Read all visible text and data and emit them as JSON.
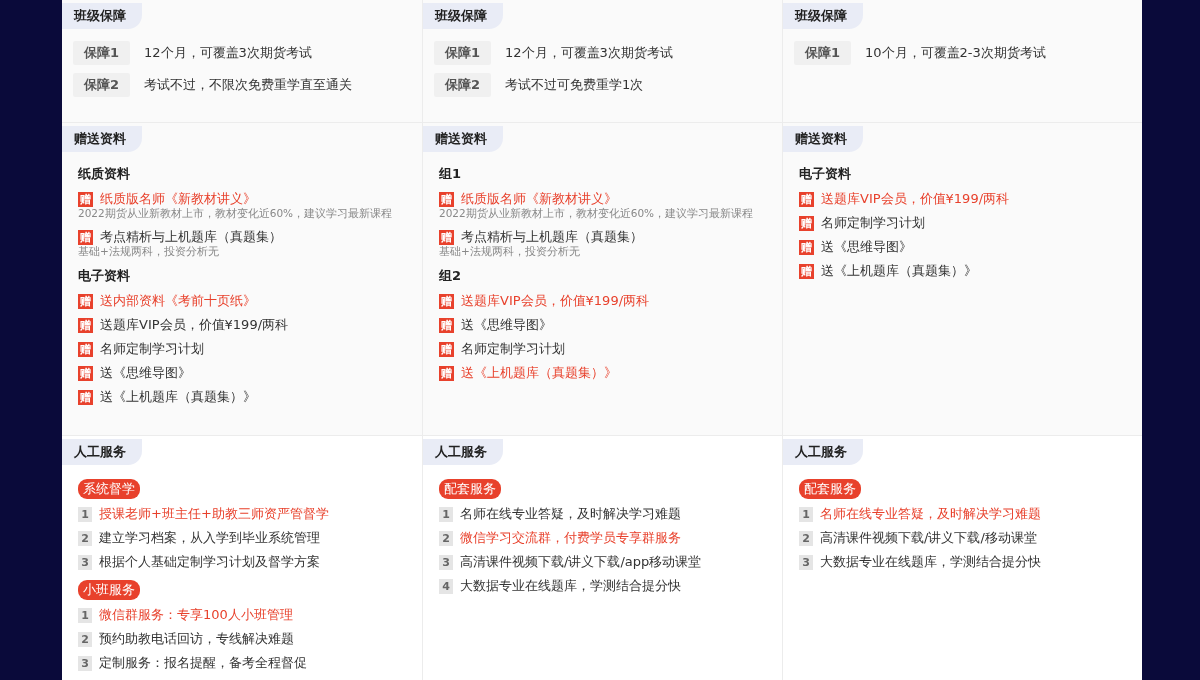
{
  "sections": [
    {
      "kind": "guarantee",
      "columns": [
        {
          "titles": [
            "班级保障"
          ],
          "rows": [
            {
              "label": "保障1",
              "text": "12个月，可覆盖3次期货考试"
            },
            {
              "label": "保障2",
              "text": "考试不过，不限次免费重学直至通关"
            }
          ]
        },
        {
          "titles": [
            "班级保障"
          ],
          "rows": [
            {
              "label": "保障1",
              "text": "12个月，可覆盖3次期货考试"
            },
            {
              "label": "保障2",
              "text": "考试不过可免费重学1次"
            }
          ]
        },
        {
          "titles": [
            "班级保障"
          ],
          "rows": [
            {
              "label": "保障1",
              "text": "10个月，可覆盖2-3次期货考试"
            }
          ]
        }
      ]
    },
    {
      "kind": "materials",
      "columns": [
        {
          "titles": [
            "赠送资料"
          ],
          "groups": [
            {
              "heading": "纸质资料",
              "items": [
                {
                  "mark": "赠",
                  "text": "纸质版名师《新教材讲义》",
                  "highlight": true,
                  "note": "2022期货从业新教材上市，教材变化近60%，建议学习最新课程"
                },
                {
                  "mark": "赠",
                  "text": "考点精析与上机题库（真题集）",
                  "highlight": false,
                  "note": "基础+法规两科，投资分析无"
                }
              ]
            },
            {
              "heading": "电子资料",
              "items": [
                {
                  "mark": "赠",
                  "text": "送内部资料《考前十页纸》",
                  "highlight": true
                },
                {
                  "mark": "赠",
                  "text": "送题库VIP会员，价值¥199/两科",
                  "highlight": false
                },
                {
                  "mark": "赠",
                  "text": "名师定制学习计划",
                  "highlight": false
                },
                {
                  "mark": "赠",
                  "text": "送《思维导图》",
                  "highlight": false
                },
                {
                  "mark": "赠",
                  "text": "送《上机题库（真题集）》",
                  "highlight": false
                }
              ]
            }
          ]
        },
        {
          "titles": [
            "赠送资料"
          ],
          "groups": [
            {
              "heading": "组1",
              "items": [
                {
                  "mark": "赠",
                  "text": "纸质版名师《新教材讲义》",
                  "highlight": true,
                  "note": "2022期货从业新教材上市，教材变化近60%，建议学习最新课程"
                },
                {
                  "mark": "赠",
                  "text": "考点精析与上机题库（真题集）",
                  "highlight": false,
                  "note": "基础+法规两科，投资分析无"
                }
              ]
            },
            {
              "heading": "组2",
              "items": [
                {
                  "mark": "赠",
                  "text": "送题库VIP会员，价值¥199/两科",
                  "highlight": true
                },
                {
                  "mark": "赠",
                  "text": "送《思维导图》",
                  "highlight": false
                },
                {
                  "mark": "赠",
                  "text": "名师定制学习计划",
                  "highlight": false
                },
                {
                  "mark": "赠",
                  "text": "送《上机题库（真题集）》",
                  "highlight": true
                }
              ]
            }
          ]
        },
        {
          "titles": [
            "赠送资料"
          ],
          "groups": [
            {
              "heading": "电子资料",
              "items": [
                {
                  "mark": "赠",
                  "text": "送题库VIP会员，价值¥199/两科",
                  "highlight": true
                },
                {
                  "mark": "赠",
                  "text": "名师定制学习计划",
                  "highlight": false
                },
                {
                  "mark": "赠",
                  "text": "送《思维导图》",
                  "highlight": false
                },
                {
                  "mark": "赠",
                  "text": "送《上机题库（真题集）》",
                  "highlight": false
                }
              ]
            }
          ]
        }
      ]
    },
    {
      "kind": "service",
      "columns": [
        {
          "titles": [
            "人工服务"
          ],
          "groups": [
            {
              "tag": "系统督学",
              "items": [
                {
                  "num": "1",
                  "text": "授课老师+班主任+助教三师资严管督学",
                  "highlight": true
                },
                {
                  "num": "2",
                  "text": "建立学习档案，从入学到毕业系统管理",
                  "highlight": false
                },
                {
                  "num": "3",
                  "text": "根据个人基础定制学习计划及督学方案",
                  "highlight": false
                }
              ]
            },
            {
              "tag": "小班服务",
              "items": [
                {
                  "num": "1",
                  "text": "微信群服务：专享100人小班管理",
                  "highlight": true
                },
                {
                  "num": "2",
                  "text": "预约助教电话回访，专线解决难题",
                  "highlight": false
                },
                {
                  "num": "3",
                  "text": "定制服务：报名提醒，备考全程督促",
                  "highlight": false
                }
              ]
            }
          ]
        },
        {
          "titles": [
            "人工服务"
          ],
          "groups": [
            {
              "tag": "配套服务",
              "items": [
                {
                  "num": "1",
                  "text": "名师在线专业答疑，及时解决学习难题",
                  "highlight": false
                },
                {
                  "num": "2",
                  "text": "微信学习交流群，付费学员专享群服务",
                  "highlight": true
                },
                {
                  "num": "3",
                  "text": "高清课件视频下载/讲义下载/app移动课堂",
                  "highlight": false
                },
                {
                  "num": "4",
                  "text": "大数据专业在线题库，学测结合提分快",
                  "highlight": false
                }
              ]
            }
          ]
        },
        {
          "titles": [
            "人工服务"
          ],
          "groups": [
            {
              "tag": "配套服务",
              "items": [
                {
                  "num": "1",
                  "text": "名师在线专业答疑，及时解决学习难题",
                  "highlight": true
                },
                {
                  "num": "2",
                  "text": "高清课件视频下载/讲义下载/移动课堂",
                  "highlight": false
                },
                {
                  "num": "3",
                  "text": "大数据专业在线题库，学测结合提分快",
                  "highlight": false
                }
              ]
            }
          ]
        }
      ]
    }
  ]
}
